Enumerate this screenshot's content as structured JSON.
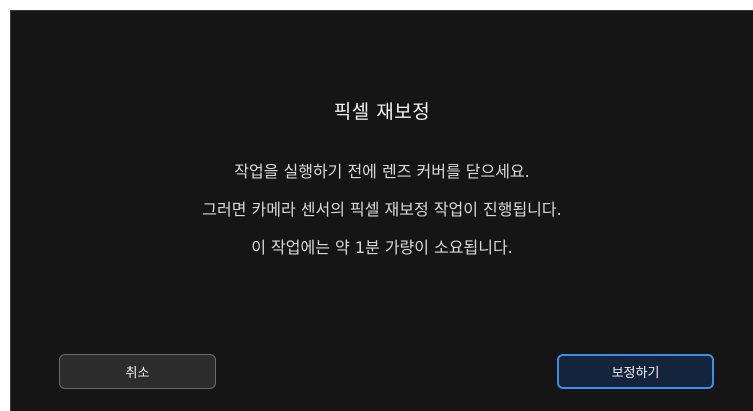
{
  "dialog": {
    "title": "픽셀 재보정",
    "message_lines": [
      "작업을 실행하기 전에 렌즈 커버를 닫으세요.",
      "그러면 카메라 센서의 픽셀 재보정 작업이 진행됩니다.",
      "이 작업에는 약 1분 가량이 소요됩니다."
    ],
    "cancel_label": "취소",
    "confirm_label": "보정하기"
  },
  "colors": {
    "background": "#151515",
    "confirm_border": "#3d8fe6",
    "cancel_border": "#6a6a6a"
  }
}
